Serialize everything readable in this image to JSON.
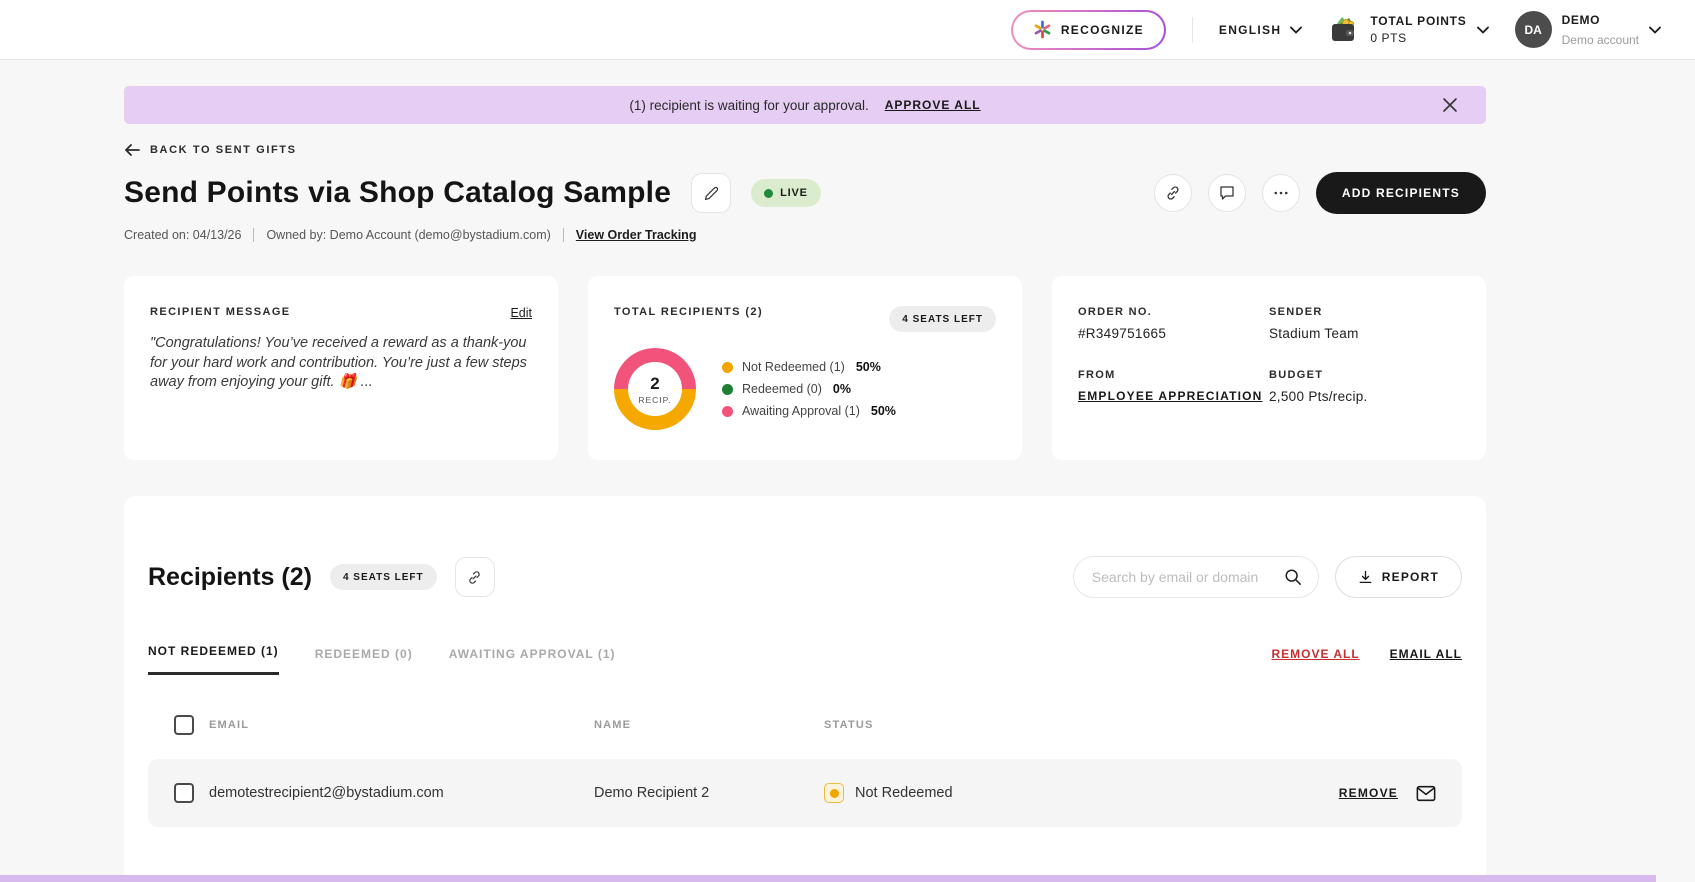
{
  "header": {
    "recognize": "RECOGNIZE",
    "language": "ENGLISH",
    "points_label": "TOTAL POINTS",
    "points_value": "0 PTS",
    "avatar_initials": "DA",
    "account_name": "DEMO",
    "account_subtitle": "Demo account"
  },
  "banner": {
    "message": "(1) recipient is waiting for your approval.",
    "action": "APPROVE ALL"
  },
  "page": {
    "back": "BACK TO SENT GIFTS",
    "title": "Send Points via Shop Catalog Sample",
    "status": "LIVE",
    "add_button": "ADD RECIPIENTS",
    "created": "Created on: 04/13/26",
    "owner": "Owned by: Demo Account (demo@bystadium.com)",
    "tracking": "View Order Tracking"
  },
  "message_card": {
    "title": "RECIPIENT MESSAGE",
    "edit": "Edit",
    "body": "\"Congratulations! You’ve received a reward as a thank-you for your hard work and contribution. You’re just a few steps away from enjoying your gift. 🎁 ..."
  },
  "summary_card": {
    "title": "TOTAL RECIPIENTS (2)",
    "seats": "4 SEATS LEFT",
    "donut_value": "2",
    "donut_label": "RECIP.",
    "colors": {
      "not_redeemed": "#F0A500",
      "redeemed": "#1E7E34",
      "awaiting": "#F2537B"
    },
    "legend": [
      {
        "label": "Not Redeemed (1)",
        "pct": "50%"
      },
      {
        "label": "Redeemed (0)",
        "pct": "0%"
      },
      {
        "label": "Awaiting Approval (1)",
        "pct": "50%"
      }
    ]
  },
  "order_card": {
    "order_label": "ORDER NO.",
    "order_value": "#R349751665",
    "sender_label": "SENDER",
    "sender_value": "Stadium Team",
    "from_label": "FROM",
    "from_value": "EMPLOYEE APPRECIATION",
    "budget_label": "BUDGET",
    "budget_value": "2,500 Pts/recip."
  },
  "recipients": {
    "heading": "Recipients (2)",
    "seats": "4 SEATS LEFT",
    "search_placeholder": "Search by email or domain",
    "report": "REPORT",
    "tabs": [
      {
        "label": "NOT REDEEMED (1)"
      },
      {
        "label": "REDEEMED (0)"
      },
      {
        "label": "AWAITING APPROVAL (1)"
      }
    ],
    "remove_all": "REMOVE ALL",
    "email_all": "EMAIL ALL",
    "columns": {
      "email": "EMAIL",
      "name": "NAME",
      "status": "STATUS"
    },
    "rows": [
      {
        "email": "demotestrecipient2@bystadium.com",
        "name": "Demo Recipient 2",
        "status": "Not Redeemed",
        "remove": "REMOVE"
      }
    ]
  }
}
